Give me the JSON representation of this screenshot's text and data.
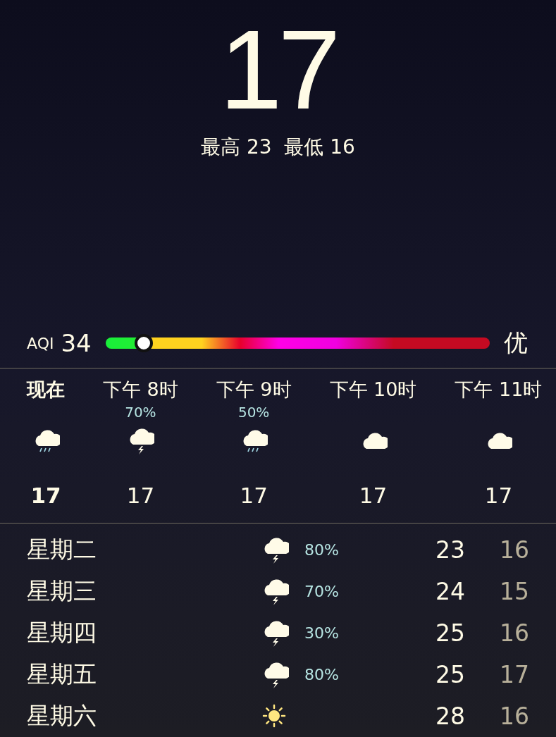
{
  "current": {
    "temperature": "17",
    "high_low": "最高 23  最低 16"
  },
  "aqi": {
    "label": "AQI",
    "value": "34",
    "level": 0.1,
    "rating": "优"
  },
  "hourly": [
    {
      "time": "现在",
      "current": true,
      "kind": "rain",
      "temperature": "17"
    },
    {
      "time": "下午 8时",
      "current": false,
      "chance": "70%",
      "kind": "thunder",
      "temperature": "17"
    },
    {
      "time": "下午 9时",
      "current": false,
      "chance": "50%",
      "kind": "rain",
      "temperature": "17"
    },
    {
      "time": "下午 10时",
      "current": false,
      "kind": "cloud",
      "temperature": "17"
    },
    {
      "time": "下午 11时",
      "current": false,
      "kind": "cloud",
      "temperature": "17"
    }
  ],
  "daily": [
    {
      "day": "星期二",
      "kind": "thunder",
      "chance": "80%",
      "high": "23",
      "low": "16"
    },
    {
      "day": "星期三",
      "kind": "thunder",
      "chance": "70%",
      "high": "24",
      "low": "15"
    },
    {
      "day": "星期四",
      "kind": "thunder",
      "chance": "30%",
      "high": "25",
      "low": "16"
    },
    {
      "day": "星期五",
      "kind": "thunder",
      "chance": "80%",
      "high": "25",
      "low": "17"
    },
    {
      "day": "星期六",
      "kind": "sun",
      "high": "28",
      "low": "16"
    }
  ]
}
